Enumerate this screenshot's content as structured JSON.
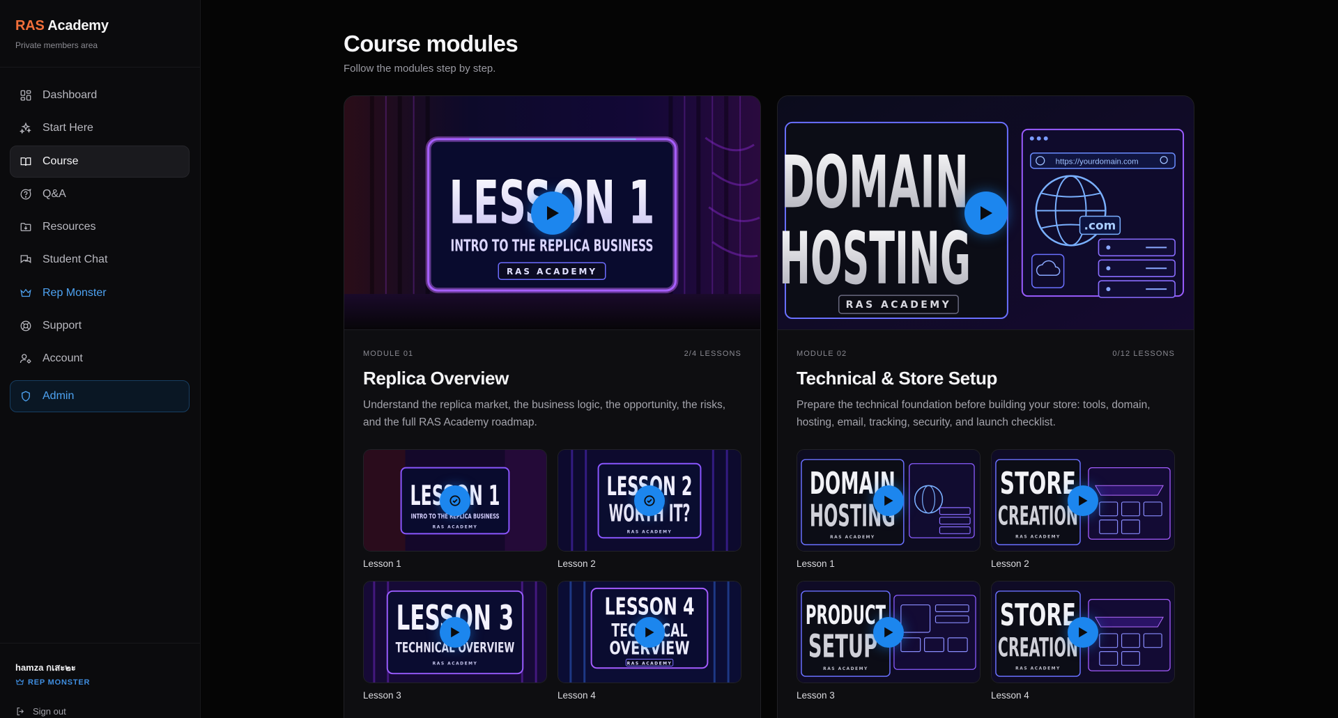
{
  "brand": {
    "accent": "RAS",
    "rest": "Academy",
    "subtitle": "Private members area"
  },
  "nav": [
    {
      "label": "Dashboard",
      "icon": "grid-icon"
    },
    {
      "label": "Start Here",
      "icon": "sparkles-icon"
    },
    {
      "label": "Course",
      "icon": "book-open-icon",
      "active": true
    },
    {
      "label": "Q&A",
      "icon": "question-circle-icon"
    },
    {
      "label": "Resources",
      "icon": "folder-download-icon"
    },
    {
      "label": "Student Chat",
      "icon": "chat-bubbles-icon"
    },
    {
      "label": "Rep Monster",
      "icon": "crown-icon"
    },
    {
      "label": "Support",
      "icon": "lifebuoy-icon"
    },
    {
      "label": "Account",
      "icon": "user-cog-icon"
    },
    {
      "label": "Admin",
      "icon": "shield-icon"
    }
  ],
  "user": {
    "name": "hamza กเสะ๒ะ",
    "role": "REP MONSTER",
    "signout": "Sign out"
  },
  "page": {
    "title": "Course modules",
    "subtitle": "Follow the modules step by step."
  },
  "modules": [
    {
      "number": "MODULE 01",
      "lessons_count": "2/4 LESSONS",
      "title": "Replica Overview",
      "description": "Understand the replica market, the business logic, the opportunity, the risks, and the full RAS Academy roadmap.",
      "hero": {
        "line1": "LESSON 1",
        "line2": "INTRO TO THE REPLICA BUSINESS",
        "badge": "RAS ACADEMY"
      },
      "lessons": [
        {
          "label": "Lesson 1",
          "art1": "LESSON 1",
          "art2": "INTRO TO THE REPLICA BUSINESS",
          "art3": "RAS ACADEMY",
          "status": "done"
        },
        {
          "label": "Lesson 2",
          "art1": "LESSON 2",
          "art2": "WORTH IT?",
          "art3": "RAS ACADEMY",
          "status": "done"
        },
        {
          "label": "Lesson 3",
          "art1": "LESSON 3",
          "art2": "TECHNICAL OVERVIEW",
          "art3": "RAS ACADEMY",
          "status": "play"
        },
        {
          "label": "Lesson 4",
          "art1": "LESSON 4",
          "art2": "TECHNICAL",
          "art2b": "OVERVIEW",
          "art3": "RAS ACADEMY",
          "status": "play"
        }
      ]
    },
    {
      "number": "MODULE 02",
      "lessons_count": "0/12 LESSONS",
      "title": "Technical & Store Setup",
      "description": "Prepare the technical foundation before building your store: tools, domain, hosting, email, tracking, security, and launch checklist.",
      "hero": {
        "line1": "DOMAIN",
        "line2": "HOSTING",
        "badge": "RAS ACADEMY",
        "url": "https://yourdomain.com",
        "tld": ".com"
      },
      "lessons": [
        {
          "label": "Lesson 1",
          "art1": "DOMAIN",
          "art2": "HOSTING",
          "art3": "RAS ACADEMY",
          "status": "play"
        },
        {
          "label": "Lesson 2",
          "art1": "STORE",
          "art2": "CREATION",
          "art3": "RAS ACADEMY",
          "status": "play"
        },
        {
          "label": "Lesson 3",
          "art1": "PRODUCT",
          "art2": "SETUP",
          "art3": "RAS ACADEMY",
          "status": "play"
        },
        {
          "label": "Lesson 4",
          "art1": "STORE",
          "art2": "CREATION",
          "art3": "RAS ACADEMY",
          "status": "play"
        }
      ]
    }
  ],
  "colors": {
    "accent_orange": "#f26f3a",
    "accent_blue": "#1c86ee",
    "neon_purple": "#a43cff"
  }
}
